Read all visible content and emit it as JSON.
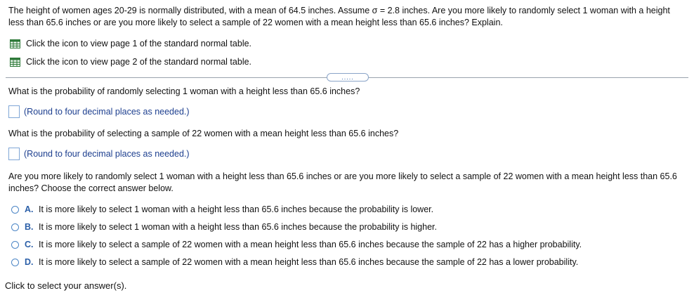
{
  "problem_text": "The height of women ages 20-29 is normally distributed, with a mean of 64.5 inches. Assume σ = 2.8 inches. Are you more likely to randomly select 1 woman with a height less than 65.6 inches or are you more likely to select a sample of 22 women with a mean height less than 65.6 inches? Explain.",
  "table_links": [
    {
      "label": "Click the icon to view page 1 of the standard normal table."
    },
    {
      "label": "Click the icon to view page 2 of the standard normal table."
    }
  ],
  "expander_label": ".....",
  "questions": [
    {
      "text": "What is the probability of randomly selecting 1 woman with a height less than 65.6 inches?",
      "hint": "(Round to four decimal places as needed.)"
    },
    {
      "text": "What is the probability of selecting a sample of 22 women with a mean height less than 65.6 inches?",
      "hint": "(Round to four decimal places as needed.)"
    }
  ],
  "choice_question": "Are you more likely to randomly select 1 woman with a height less than 65.6 inches or are you more likely to select a sample of 22 women with a mean height less than 65.6 inches? Choose the correct answer below.",
  "options": [
    {
      "letter": "A.",
      "text": "It is more likely to select 1 woman with a height less than 65.6 inches because the probability is lower."
    },
    {
      "letter": "B.",
      "text": "It is more likely to select 1 woman with a height less than 65.6 inches because the probability is higher."
    },
    {
      "letter": "C.",
      "text": "It is more likely to select a sample of 22 women with a mean height less than 65.6 inches because the sample of 22 has a higher probability."
    },
    {
      "letter": "D.",
      "text": "It is more likely to select a sample of 22 women with a mean height less than 65.6 inches because the sample of 22 has a lower probability."
    }
  ],
  "footer_text": "Click to select your answer(s).",
  "colors": {
    "accent": "#2b5fa8",
    "hint": "#1d3f8f",
    "table_icon": "#2f7a3a",
    "divider": "#9aa3ad"
  }
}
